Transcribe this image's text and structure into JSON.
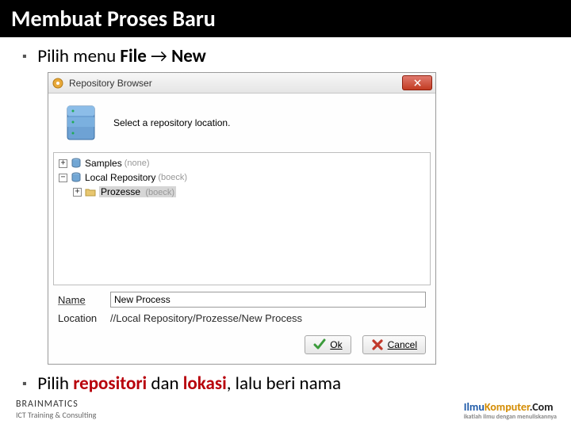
{
  "slide": {
    "title": "Membuat Proses Baru",
    "bullet1_prefix": "Pilih menu ",
    "bullet1_file": "File",
    "bullet1_arrow": " → ",
    "bullet1_new": "New",
    "bullet2_pilih": "Pilih ",
    "bullet2_repo": "repositori",
    "bullet2_dan": " dan ",
    "bullet2_lokasi": "lokasi",
    "bullet2_rest": ", lalu beri nama"
  },
  "dlg": {
    "title": "Repository Browser",
    "intro": "Select a repository location.",
    "tree": {
      "samples": {
        "label": "Samples",
        "suffix": "(none)"
      },
      "local": {
        "label": "Local Repository",
        "suffix": "(boeck)"
      },
      "prozesse": {
        "label": "Prozesse",
        "suffix": "(boeck)"
      }
    },
    "name_label": "Name",
    "name_value": "New Process",
    "location_label": "Location",
    "location_value": "//Local Repository/Prozesse/New Process",
    "ok_label": "Ok",
    "cancel_label": "Cancel"
  },
  "footer": {
    "brand": "BRAINMATICS",
    "tag": "ICT Training & Consulting",
    "site1": "Ilmu",
    "site2": "Komputer",
    "site3": ".Com",
    "site_tag": "ikatlah ilmu dengan menuliskannya"
  }
}
